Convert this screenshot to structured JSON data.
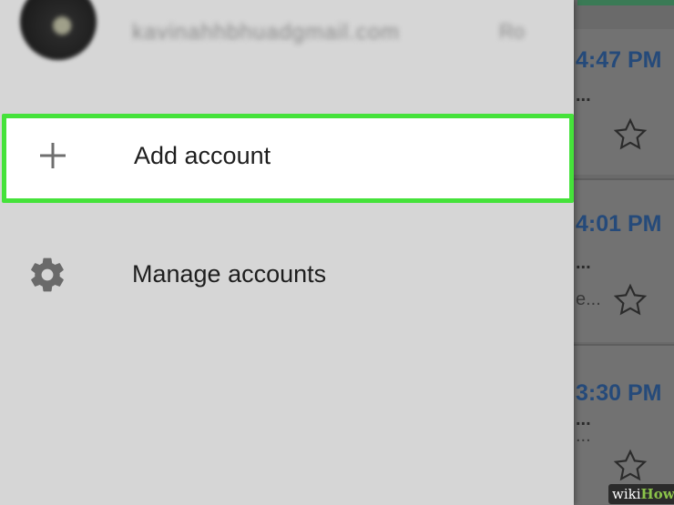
{
  "drawer": {
    "account_email": "kavinahhbhuadgmail.com",
    "account_short": "Ro",
    "add_account_label": "Add account",
    "manage_accounts_label": "Manage accounts"
  },
  "inbox": {
    "rows": [
      {
        "time": "4:47 PM",
        "line1": "...",
        "line2": ""
      },
      {
        "time": "4:01 PM",
        "line1": "...",
        "line2": "e..."
      },
      {
        "time": "3:30 PM",
        "line1": "...",
        "line2": "..."
      }
    ]
  },
  "icons": {
    "add": "plus-icon",
    "manage": "gear-icon",
    "star": "star-outline-icon"
  },
  "colors": {
    "highlight": "#45e23a",
    "time_text": "#254a7a"
  },
  "watermark": {
    "part1": "wiki",
    "part2": "How"
  }
}
